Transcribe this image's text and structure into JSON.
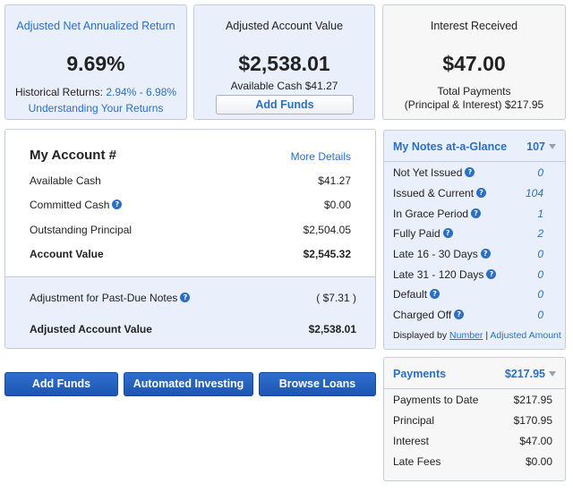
{
  "return_card": {
    "title": "Adjusted Net Annualized Return",
    "value": "9.69%",
    "historical_label": "Historical Returns:",
    "historical_range": "2.94% - 6.98%",
    "understanding_link": "Understanding Your Returns"
  },
  "account_value_card": {
    "title": "Adjusted Account Value",
    "value": "$2,538.01",
    "available_cash": "Available Cash $41.27",
    "add_funds_label": "Add Funds"
  },
  "interest_card": {
    "title": "Interest Received",
    "value": "$47.00",
    "line1": "Total Payments",
    "line2": "(Principal & Interest) $217.95"
  },
  "my_account": {
    "title": "My Account #",
    "more_details": "More Details",
    "rows": [
      {
        "label": "Available Cash",
        "value": "$41.27"
      },
      {
        "label": "Committed Cash",
        "value": "$0.00"
      },
      {
        "label": "Outstanding Principal",
        "value": "$2,504.05"
      },
      {
        "label": "Account Value",
        "value": "$2,545.32"
      }
    ],
    "adjustment": {
      "label": "Adjustment for Past-Due Notes",
      "value": "( $7.31 )"
    },
    "adjusted_value": {
      "label": "Adjusted Account Value",
      "value": "$2,538.01"
    }
  },
  "actions": {
    "add_funds": "Add Funds",
    "automated_investing": "Automated Investing",
    "browse_loans": "Browse Loans"
  },
  "notes": {
    "title": "My Notes at-a-Glance",
    "count": "107",
    "rows": [
      {
        "label": "Not Yet Issued",
        "value": "0"
      },
      {
        "label": "Issued & Current",
        "value": "104"
      },
      {
        "label": "In Grace Period",
        "value": "1"
      },
      {
        "label": "Fully Paid",
        "value": "2"
      },
      {
        "label": "Late 16 - 30 Days",
        "value": "0"
      },
      {
        "label": "Late 31 - 120 Days",
        "value": "0"
      },
      {
        "label": "Default",
        "value": "0"
      },
      {
        "label": "Charged Off",
        "value": "0"
      }
    ],
    "displayed_by": "Displayed by",
    "number_link": "Number",
    "separator": "|",
    "adjusted_amount_link": "Adjusted Amount"
  },
  "payments": {
    "title": "Payments",
    "total": "$217.95",
    "rows": [
      {
        "label": "Payments to Date",
        "value": "$217.95"
      },
      {
        "label": "Principal",
        "value": "$170.95"
      },
      {
        "label": "Interest",
        "value": "$47.00"
      },
      {
        "label": "Late Fees",
        "value": "$0.00"
      }
    ]
  },
  "colors": {
    "accent": "#2a6fc4",
    "button": "#2463c3",
    "panel_blue": "#e9f0fb"
  }
}
